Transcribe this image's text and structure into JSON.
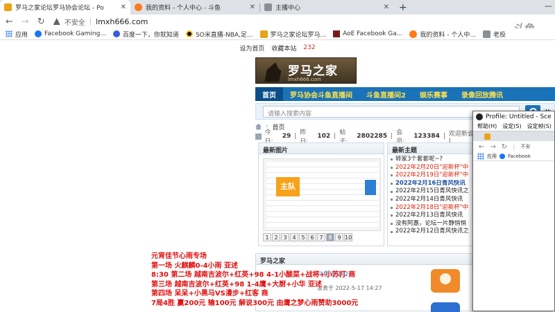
{
  "browser": {
    "tabs": [
      {
        "title": "罗马之家论坛罗马协会论坛 - Po",
        "active": true
      },
      {
        "title": "我的资料 - 个人中心 - 斗鱼",
        "active": false
      },
      {
        "title": "主播中心",
        "active": false
      }
    ],
    "new_tab": "+",
    "window_controls": "—",
    "insecure_label": "不安全",
    "url": "lmxh666.com",
    "bookmarks": [
      "应用",
      "Facebook Gaming...",
      "百度一下，你就知道",
      "SO米直播-NBA,足...",
      "罗马之家论坛罗马...",
      "AoE Facebook Ga...",
      "我的资料 - 个人中...",
      "老投"
    ],
    "watermark": "斗鱼"
  },
  "site": {
    "topline": {
      "set_home": "设为首页",
      "bookmark": "收藏本站",
      "count": "232"
    },
    "logo": {
      "name": "罗马之家",
      "domain": "lmxh666.com"
    },
    "nav": [
      "首页",
      "罗马协会斗鱼直播间",
      "斗鱼直播间2",
      "娱乐赛事",
      "录像回放腾讯"
    ],
    "search_placeholder": "请输入搜索内容",
    "hot_label": "热",
    "breadcrumb": "首页",
    "stats": {
      "today_label": "今日:",
      "today": "29",
      "yesterday_label": "昨日:",
      "yesterday": "102",
      "posts_label": "帖子:",
      "posts": "2802285",
      "members_label": "会员:",
      "members": "123384",
      "welcome_label": "欢迎新会员: J"
    },
    "latest_pics": {
      "header": "最新图片",
      "badge": "主队",
      "pages": [
        "1",
        "2",
        "3",
        "4",
        "5",
        "6",
        "7",
        "8",
        "9",
        "10"
      ],
      "current_page": "8"
    },
    "latest_topics": {
      "header": "最新主题",
      "items": [
        {
          "text": "转家3个套套呢~?",
          "style": "normal"
        },
        {
          "text": "2022年2月20日\"迎新杯\"中",
          "style": "red"
        },
        {
          "text": "2022年2月19日\"迎新杯\"中",
          "style": "red"
        },
        {
          "text": "2022年2月16日青风快讯",
          "style": "blue"
        },
        {
          "text": "2022年2月15日青风快讯之",
          "style": "normal"
        },
        {
          "text": "2022年2月14日青风快讯",
          "style": "normal"
        },
        {
          "text": "2022年2月18日\"迎新杯\"中",
          "style": "red"
        },
        {
          "text": "2022年2月13日青风快讯",
          "style": "normal"
        },
        {
          "text": "没有阿嘉，论坛一片静悄悄",
          "style": "normal"
        },
        {
          "text": "2022年2月12日青风快讯之",
          "style": "normal"
        }
      ]
    },
    "forum": {
      "header": "罗马之家",
      "link": "斗鱼通知(2)",
      "meta": "发表于 2022-5-17 14:27"
    }
  },
  "popup": {
    "title": "Profile: Untitled - Sce",
    "menu": [
      "帮助(H)",
      "设定(S)",
      "设定帧(S)"
    ],
    "insecure": "不安",
    "bookmarks": [
      "应用",
      "Facebook"
    ]
  },
  "overlay": {
    "lines": [
      "元宵佳节心雨专场",
      "第一场  火麒麟0-4小雨  亚述",
      "8:30  第二场  越南吉波尔+红英+98 4-1小酸菜+战将+小苏打  商",
      "第三场  越南吉波尔+红英+98 1-4鹰+大厨+小华  亚述",
      "第四场  呆呆+小黑马VS漫步+红客  商",
      "7局4胜  赢200元 输100元 解说300元 由鹰之梦心雨赞助3000元"
    ]
  }
}
